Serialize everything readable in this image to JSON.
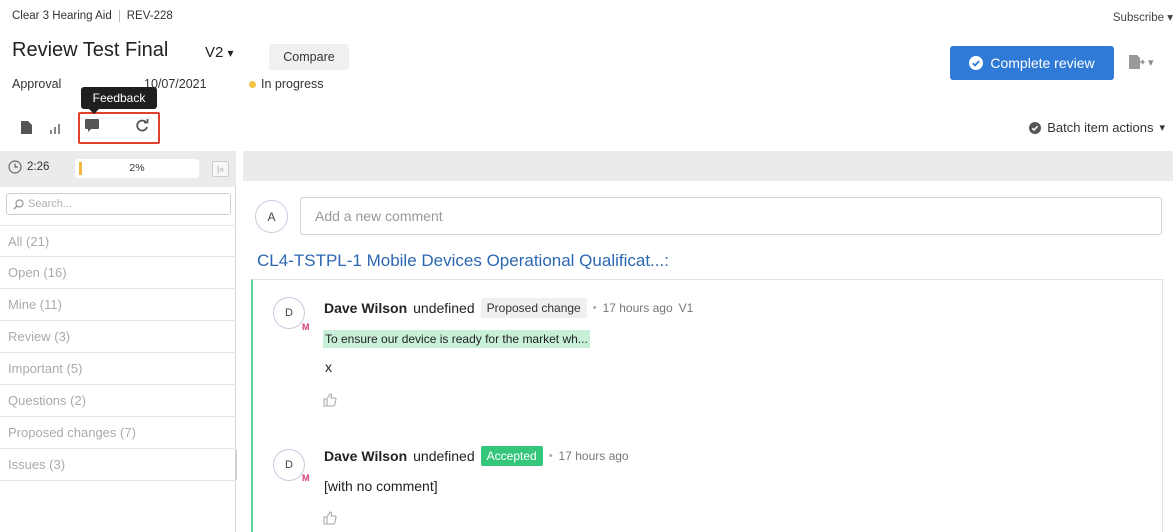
{
  "breadcrumb": {
    "project": "Clear 3 Hearing Aid",
    "item": "REV-228"
  },
  "subscribe_label": "Subscribe",
  "review": {
    "title": "Review Test Final",
    "version": "V2",
    "compare_label": "Compare",
    "approval_label": "Approval",
    "date": "10/07/2021",
    "status": "In progress",
    "status_color": "#f6c344"
  },
  "tooltip": "Feedback",
  "complete_review_label": "Complete review",
  "batch_actions_label": "Batch item actions",
  "timer": {
    "time": "2:26",
    "progress_percent": 2,
    "progress_label": "2%"
  },
  "search": {
    "placeholder": "Search...",
    "value": ""
  },
  "filters": [
    {
      "label": "All (21)"
    },
    {
      "label": "Open (16)"
    },
    {
      "label": "Mine (11)"
    },
    {
      "label": "Review (3)"
    },
    {
      "label": "Important (5)"
    },
    {
      "label": "Questions (2)"
    },
    {
      "label": "Proposed changes (7)"
    },
    {
      "label": "Issues (3)"
    }
  ],
  "new_comment": {
    "avatar": "A",
    "placeholder": "Add a new comment"
  },
  "section_title": "CL4-TSTPL-1 Mobile Devices Operational Qualificat...:",
  "comments": [
    {
      "avatar": "D",
      "avatar_badge": "M",
      "author": "Dave Wilson",
      "author_suffix": "undefined",
      "tag": "Proposed change",
      "time": "17 hours ago",
      "version": "V1",
      "quote": "To ensure our device is ready for the market wh...",
      "text": "x"
    },
    {
      "avatar": "D",
      "avatar_badge": "M",
      "author": "Dave Wilson",
      "author_suffix": "undefined",
      "tag": "Accepted",
      "time": "17 hours ago",
      "text": "[with no comment]"
    }
  ],
  "colors": {
    "primary_button": "#2f7ad6",
    "link": "#2b67b2",
    "accepted": "#34c77b",
    "thread_border": "#5fd39a",
    "highlight_box": "#e2402f"
  }
}
